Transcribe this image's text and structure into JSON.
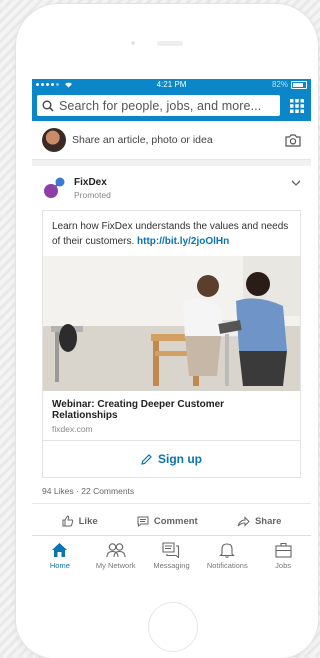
{
  "status": {
    "time": "4:21 PM",
    "battery": "82%"
  },
  "search": {
    "placeholder": "Search for people, jobs, and more..."
  },
  "share": {
    "prompt": "Share an article, photo or idea"
  },
  "post": {
    "company": "FixDex",
    "label": "Promoted",
    "text": "Learn how FixDex understands the values and needs of their customers. ",
    "link": "http://bit.ly/2joOlHn",
    "webinar_title": "Webinar: Creating Deeper Customer Relationships",
    "domain": "fixdex.com",
    "cta": "Sign up",
    "likes": "94 Likes",
    "comments": "22 Comments",
    "actions": {
      "like": "Like",
      "comment": "Comment",
      "share": "Share"
    }
  },
  "tabs": [
    {
      "label": "Home",
      "icon": "home-icon",
      "active": true
    },
    {
      "label": "My Network",
      "icon": "network-icon"
    },
    {
      "label": "Messaging",
      "icon": "messaging-icon"
    },
    {
      "label": "Notifications",
      "icon": "bell-icon"
    },
    {
      "label": "Jobs",
      "icon": "briefcase-icon"
    }
  ],
  "colors": {
    "brand": "#0a86c9",
    "link": "#0a73b1"
  }
}
